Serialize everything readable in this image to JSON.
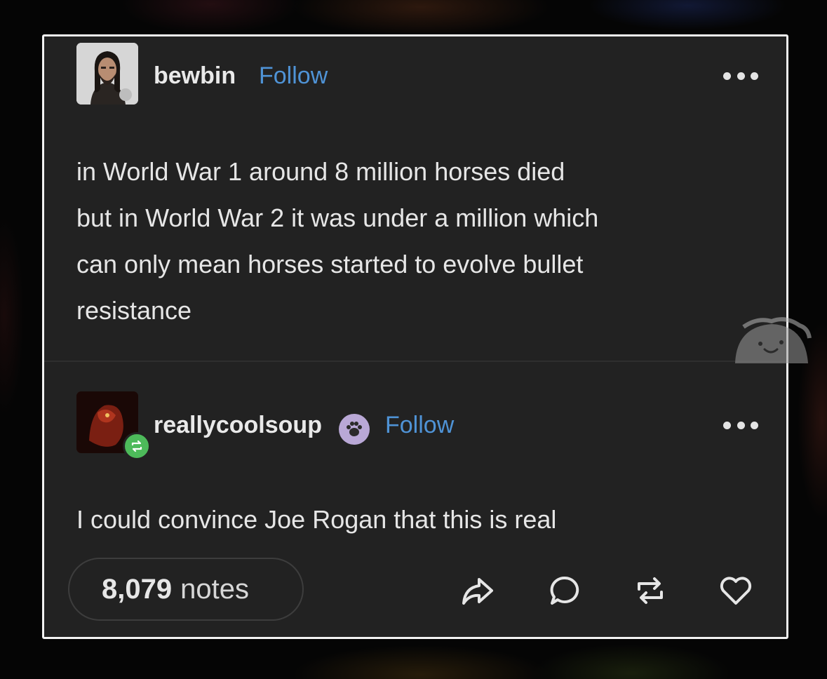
{
  "post": {
    "author": "bewbin",
    "follow_label": "Follow",
    "avatar": "person-photo-avatar",
    "more_icon": "more-options-icon",
    "text": "in World War 1 around 8 million horses died\nbut in World War 2 it was under a million which\ncan only mean horses started to evolve bullet\nresistance"
  },
  "reblog": {
    "author": "reallycoolsoup",
    "follow_label": "Follow",
    "avatar": "red-creature-avatar",
    "badge_icon": "reblog-icon",
    "paw_icon": "paw-badge-icon",
    "more_icon": "more-options-icon",
    "text": "I could convince Joe Rogan that this is real"
  },
  "footer": {
    "notes_count": "8,079",
    "notes_label": "notes",
    "actions": [
      "share-icon",
      "comment-icon",
      "reblog-icon",
      "heart-icon"
    ]
  },
  "colors": {
    "card_background": "#222222",
    "card_border": "#f2f2f2",
    "follow_blue": "#4f93d6",
    "reblog_green": "#4dba5a",
    "text": "#e6e6e6"
  }
}
